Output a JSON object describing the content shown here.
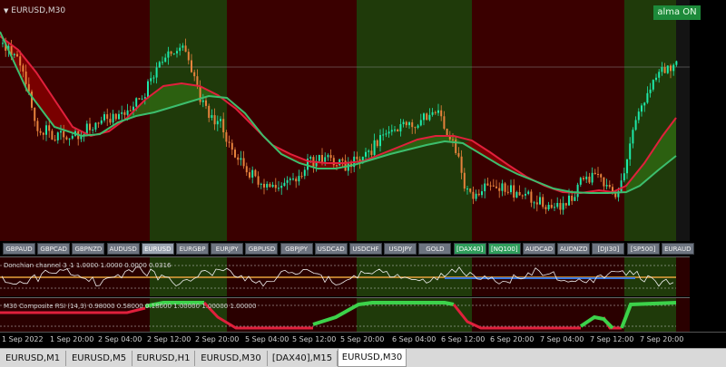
{
  "chart": {
    "symbol_title": "EURUSD,M30",
    "badge": "alma ON",
    "colors": {
      "bull": "#1de8a8",
      "bear": "#e6823c",
      "red_line": "#e0203c",
      "green_line": "#3cbe6e",
      "zone_red": "#3a0000",
      "zone_green": "#1f3a0a",
      "fill_red": "#8a0000",
      "fill_green": "#2f6a12"
    }
  },
  "symbol_buttons": [
    "GBPAUD",
    "GBPCAD",
    "GBPNZD",
    "AUDUSD",
    "EURUSD",
    "EURGBP",
    "EURJPY",
    "GBPUSD",
    "GBPJPY",
    "USDCAD",
    "USDCHF",
    "USDJPY",
    "GOLD",
    "[DAX40]",
    "[NQ100]",
    "AUDCAD",
    "AUDNZD",
    "[DJI30]",
    "[SP500]",
    "EURAUD"
  ],
  "active_symbol": "EURUSD",
  "indicators": {
    "donchian_label": "Donchian channel 3_1 1.0000 1.0000 0.0000 0.0316",
    "rsi_label": "M30 Composite RSI (14,3) 0.98000 0.58000 0.18000 1.00000 1.00000 1.00000"
  },
  "time_axis": [
    "1 Sep 2022",
    "1 Sep 20:00",
    "2 Sep 04:00",
    "2 Sep 12:00",
    "2 Sep 20:00",
    "5 Sep 04:00",
    "5 Sep 12:00",
    "5 Sep 20:00",
    "6 Sep 04:00",
    "6 Sep 12:00",
    "6 Sep 20:00",
    "7 Sep 04:00",
    "7 Sep 12:00",
    "7 Sep 20:00"
  ],
  "tabs": [
    "EURUSD,M1",
    "EURUSD,M5",
    "EURUSD,H1",
    "EURUSD,M30",
    "[DAX40],M15",
    "EURUSD,M30"
  ],
  "active_tab_index": 5
}
